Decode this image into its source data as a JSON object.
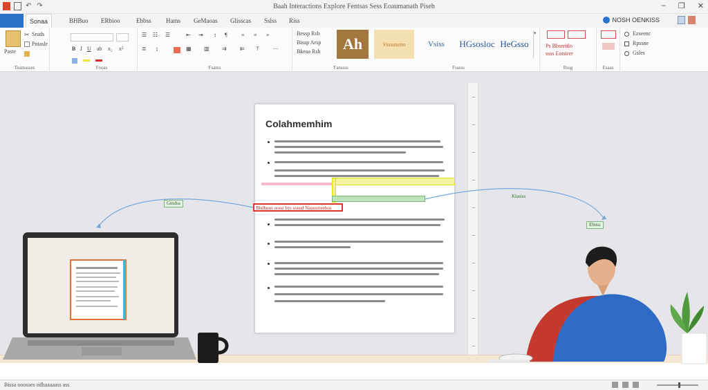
{
  "window": {
    "title": "Baah Interactions Explore Fentsas Sess Eoaumanath Piseh",
    "help_label": "NOSH OENKISS",
    "controls": [
      "–",
      "❐",
      "✕"
    ]
  },
  "tabs": {
    "file": "",
    "home": "Sonaa",
    "others": [
      "BHBuo",
      "ERbioo",
      "Ebbss",
      "Hams",
      "GeMaoas",
      "Glisscas",
      "Sslss",
      "Riss"
    ]
  },
  "ribbon": {
    "clipboard": {
      "paste": "Paste",
      "cut": "Sruds",
      "copy": "Pntasle",
      "group": "Teamasses"
    },
    "font": {
      "name": "",
      "size": "",
      "group": "Fooas"
    },
    "paragraph": {
      "group": "Fsams"
    },
    "styles": {
      "preview_lines": [
        "Bessp Rsb",
        "Bisap Arsp",
        "Bkeaa Rsh"
      ],
      "big_swatch": "Ah",
      "swatches": [
        "Vsssaseno",
        "Vsiss",
        "HGsosloc",
        "HeGsso"
      ],
      "group_left": "Fanssss",
      "group": "Fssess"
    },
    "editing": {
      "swatch_labels": [
        "Ps Bbsreitlo",
        "ssss Eotsirer"
      ],
      "group": "Rssg"
    },
    "voice": {
      "labels": [
        "Ezseenc",
        "Rpssne",
        "Gsles"
      ],
      "group": "Esaas"
    }
  },
  "document": {
    "title": "Colahmemhim",
    "red_highlight_text": "Bhdhuus oooa Irrs sousd Naussmeehos"
  },
  "comments": {
    "left": "Gmdsa",
    "right_plain": "Klasiss",
    "right_box": "Ebuss"
  },
  "statusbar": {
    "text": "Bissa ooosaes odhaaaaass ass"
  },
  "colors": {
    "accent": "#2b70c9",
    "highlight_yellow": "#f3f3a0",
    "highlight_green": "#bfe3bd",
    "highlight_red": "#e0332c",
    "shirt": "#2d6bc4",
    "chair": "#c43a2e"
  }
}
